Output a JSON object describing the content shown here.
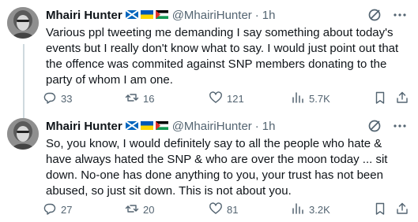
{
  "tweets": [
    {
      "author": {
        "name": "Mhairi Hunter",
        "handle": "@MhairiHunter",
        "flags": [
          "scotland-flag",
          "ukraine-flag",
          "palestine-flag"
        ]
      },
      "time": "1h",
      "separator": "·",
      "text": "Various ppl tweeting me demanding I say something about today's events but I really don't know what to say. I would just point out that the offence was commited against SNP members donating to the party of whom I am one.",
      "stats": {
        "replies": "33",
        "reposts": "16",
        "likes": "121",
        "views": "5.7K"
      }
    },
    {
      "author": {
        "name": "Mhairi Hunter",
        "handle": "@MhairiHunter",
        "flags": [
          "scotland-flag",
          "ukraine-flag",
          "palestine-flag"
        ]
      },
      "time": "1h",
      "separator": "·",
      "text": "So, you know, I would definitely say to all the people who hate & have always hated the SNP & who are over the moon today ... sit down. No-one has done anything to you, your trust has not been abused, so just sit down. This is not about you.",
      "stats": {
        "replies": "27",
        "reposts": "20",
        "likes": "81",
        "views": "3.2K"
      }
    }
  ],
  "colors": {
    "text": "#0f1419",
    "secondary": "#536471",
    "thread_line": "#cfd9de"
  }
}
